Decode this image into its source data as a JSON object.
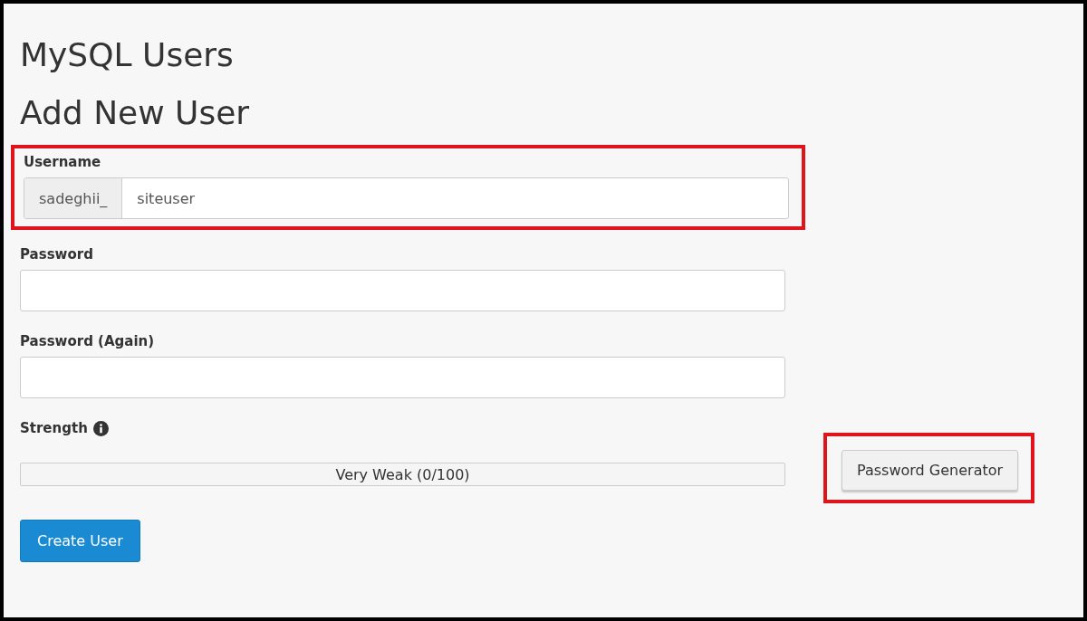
{
  "page_title": "MySQL Users",
  "section_title": "Add New User",
  "username": {
    "label": "Username",
    "prefix": "sadeghii_",
    "value": "siteuser",
    "highlighted": true
  },
  "password": {
    "label": "Password"
  },
  "password_again": {
    "label": "Password (Again)"
  },
  "strength": {
    "label": "Strength",
    "level": 0,
    "reading": "Very Weak (0/100)"
  },
  "generator": {
    "label": "Password Generator",
    "highlighted": true
  },
  "submit": {
    "label": "Create User"
  }
}
